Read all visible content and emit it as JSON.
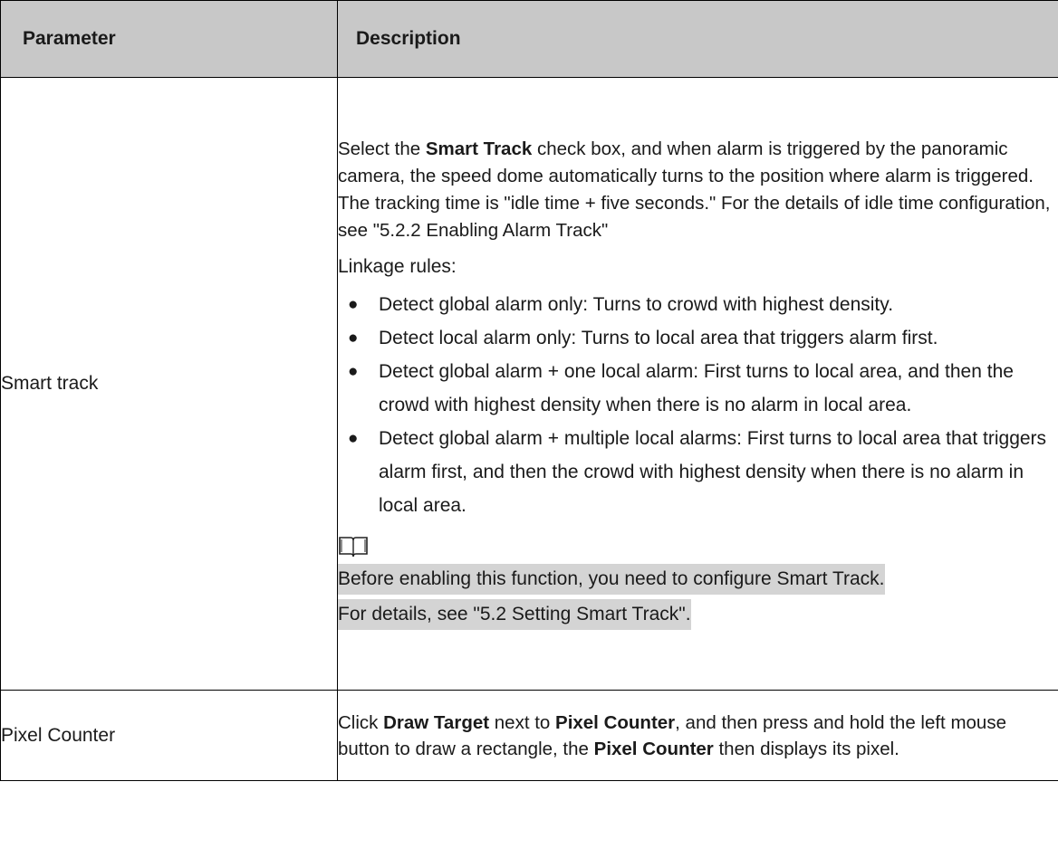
{
  "header": {
    "parameter": "Parameter",
    "description": "Description"
  },
  "rows": [
    {
      "name": "Smart track",
      "intro_pre": "Select the ",
      "intro_bold": "Smart Track",
      "intro_post": " check box, and when alarm is triggered by the panoramic camera, the speed dome automatically turns to the position where alarm is triggered. The tracking time is \"idle time + five seconds.\" For the details of idle time configuration, see \"5.2.2 Enabling Alarm Track\"",
      "linkage_heading": "Linkage rules:",
      "rules": [
        "Detect global alarm only: Turns to crowd with highest density.",
        "Detect local alarm only: Turns to local area that triggers alarm first.",
        "Detect global alarm + one local alarm: First turns to local area, and then the crowd with highest density when there is no alarm in local area.",
        "Detect global alarm + multiple local alarms: First turns to local area that triggers alarm first, and then the crowd with highest density when there is no alarm in local area."
      ],
      "note_icon": "book-icon",
      "note_line1": "Before enabling this function, you need to configure Smart Track.",
      "note_line2": "For details, see \"5.2 Setting Smart Track\"."
    },
    {
      "name": "Pixel Counter",
      "p1": "Click ",
      "b1": "Draw Target",
      "p2": " next to ",
      "b2": "Pixel Counter",
      "p3": ", and then press and hold the left mouse button to draw a rectangle, the ",
      "b3": "Pixel Counter",
      "p4": " then displays its pixel."
    }
  ]
}
